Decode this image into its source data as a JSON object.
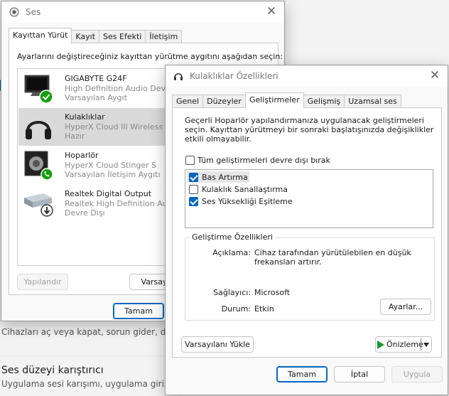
{
  "background": {
    "row1_title_fragment": "...",
    "row1_desc": "Cihazları aç veya kapat, sorun gider, diğer s",
    "row2_title": "Ses düzeyi karıştırıcı",
    "row2_desc": "Uygulama sesi karışımı, uygulama giriş ve ç"
  },
  "ses_window": {
    "title": "Ses",
    "tabs": [
      "Kayıttan Yürüt",
      "Kayıt",
      "Ses Efekti",
      "İletişim"
    ],
    "active_tab": "Kayıttan Yürüt",
    "instruction": "Ayarlarını değiştireceğiniz kayıttan yürütme aygıtını aşağıdan seçin:",
    "devices": [
      {
        "name": "GIGABYTE G24F",
        "line1": "High Definition Audio Device",
        "line2": "Varsayılan Aygıt",
        "icon": "monitor-icon",
        "badge": "default-check-badge"
      },
      {
        "name": "Kulaklıklar",
        "line1": "HyperX Cloud III Wireless",
        "line2": "Hazır",
        "icon": "headphones-icon",
        "badge": ""
      },
      {
        "name": "Hoparlör",
        "line1": "HyperX Cloud Stinger S",
        "line2": "Varsayılan İletişim Aygıtı",
        "icon": "speaker-icon",
        "badge": "communication-phone-badge"
      },
      {
        "name": "Realtek Digital Output",
        "line1": "Realtek High Definition Audio",
        "line2": "Devre Dışı",
        "icon": "digital-output-icon",
        "badge": "disabled-arrow-badge"
      }
    ],
    "selected_device": "Kulaklıklar",
    "configure_button": "Yapılandır",
    "set_default_button": "Varsay",
    "ok_button": "Tamam"
  },
  "props_window": {
    "title": "Kulaklıklar Özellikleri",
    "tabs": [
      "Genel",
      "Düzeyler",
      "Geliştirmeler",
      "Gelişmiş",
      "Uzamsal ses"
    ],
    "active_tab": "Geliştirmeler",
    "description": "Geçerli Hoparlör yapılandırmanıza uygulanacak geliştirmeleri seçin. Kayıttan yürütmeyi bir sonraki başlatışınızda değişiklikler etkili olmayabilir.",
    "disable_all_label": "Tüm geliştirmeleri devre dışı bırak",
    "disable_all_checked": false,
    "enhancements": [
      {
        "label": "Bas Artırma",
        "checked": true
      },
      {
        "label": "Kulaklık Sanallaştırma",
        "checked": false
      },
      {
        "label": "Ses Yüksekliği Eşitleme",
        "checked": true
      }
    ],
    "properties_group": {
      "legend": "Geliştirme Özellikleri",
      "description_label": "Açıklama:",
      "description_value": "Cihaz tarafından yürütülebilen en düşük frekansları artırır.",
      "provider_label": "Sağlayıcı:",
      "provider_value": "Microsoft",
      "status_label": "Durum:",
      "status_value": "Etkin",
      "settings_button": "Ayarlar..."
    },
    "restore_defaults_button": "Varsayılanı Yükle",
    "preview_button": "Önizleme",
    "ok_button": "Tamam",
    "cancel_button": "İptal",
    "apply_button": "Uygula",
    "colors": {
      "accent": "#0067c0",
      "play_green": "#1a9b2f",
      "badge_green": "#13a10e"
    }
  }
}
